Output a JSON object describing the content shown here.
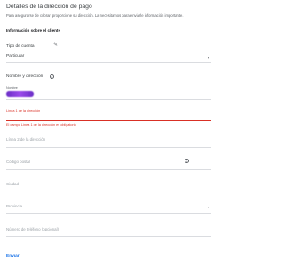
{
  "page": {
    "title": "Detalles de la dirección de pago",
    "description": "Para asegurarse de cobrar, proporcione su dirección. La necesitamos para enviarle información importante.",
    "section_title": "Información sobre el cliente"
  },
  "account_type": {
    "label": "Tipo de cuenta",
    "value": "Particular"
  },
  "name_address": {
    "label": "Nombre y dirección",
    "name_label": "Nombre"
  },
  "fields": {
    "line1_label": "Línea 1 de la dirección",
    "line1_error": "El campo Línea 1 de la dirección es obligatorio",
    "line2_placeholder": "Línea 2 de la dirección",
    "postal_placeholder": "Código postal",
    "city_placeholder": "Ciudad",
    "province_placeholder": "Provincia",
    "phone_placeholder": "Número de teléfono (opcional)"
  },
  "actions": {
    "send_label": "Enviar"
  }
}
